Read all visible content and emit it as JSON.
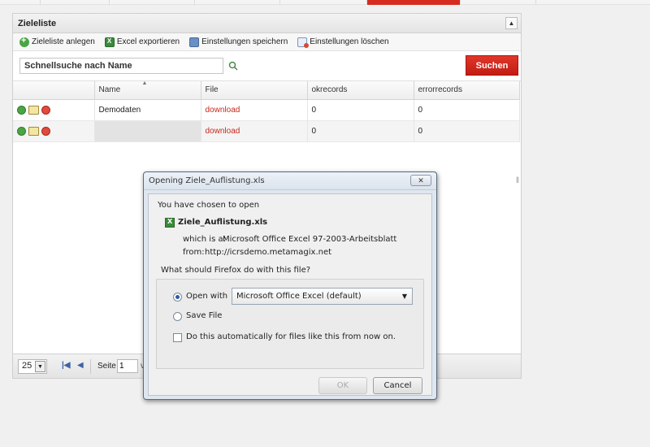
{
  "panel": {
    "title": "Zieleliste",
    "collapse_icon": "triangle-up"
  },
  "toolbar": {
    "create_label": "Zieleliste anlegen",
    "export_label": "Excel exportieren",
    "save_settings_label": "Einstellungen speichern",
    "delete_settings_label": "Einstellungen löschen"
  },
  "search": {
    "placeholder": "Schnellsuche nach Name",
    "button_label": "Suchen"
  },
  "grid": {
    "columns": [
      "Name",
      "File",
      "okrecords",
      "errorrecords"
    ],
    "rows": [
      {
        "name": "Demodaten",
        "file": "download",
        "okrecords": "0",
        "errorrecords": "0"
      },
      {
        "name": "",
        "file": "download",
        "okrecords": "0",
        "errorrecords": "0"
      }
    ]
  },
  "pager": {
    "page_size": "25",
    "page_label": "Seite",
    "page_value": "1",
    "trailing_text": "v"
  },
  "dialog": {
    "title": "Opening Ziele_Auflistung.xls",
    "intro": "You have chosen to open",
    "file_name": "Ziele_Auflistung.xls",
    "which_label": "which is a:",
    "which_value": "Microsoft Office Excel 97-2003-Arbeitsblatt",
    "from_label": "from:",
    "from_value": "http://icrsdemo.metamagix.net",
    "question": "What should Firefox do with this file?",
    "open_with_label": "Open with",
    "open_with_app": "Microsoft Office Excel (default)",
    "save_file_label": "Save File",
    "auto_label": "Do this automatically for files like this from now on.",
    "ok_label": "OK",
    "cancel_label": "Cancel",
    "selected_option": "open_with"
  },
  "colors": {
    "accent": "#d62b1f",
    "link": "#c62a1c"
  }
}
